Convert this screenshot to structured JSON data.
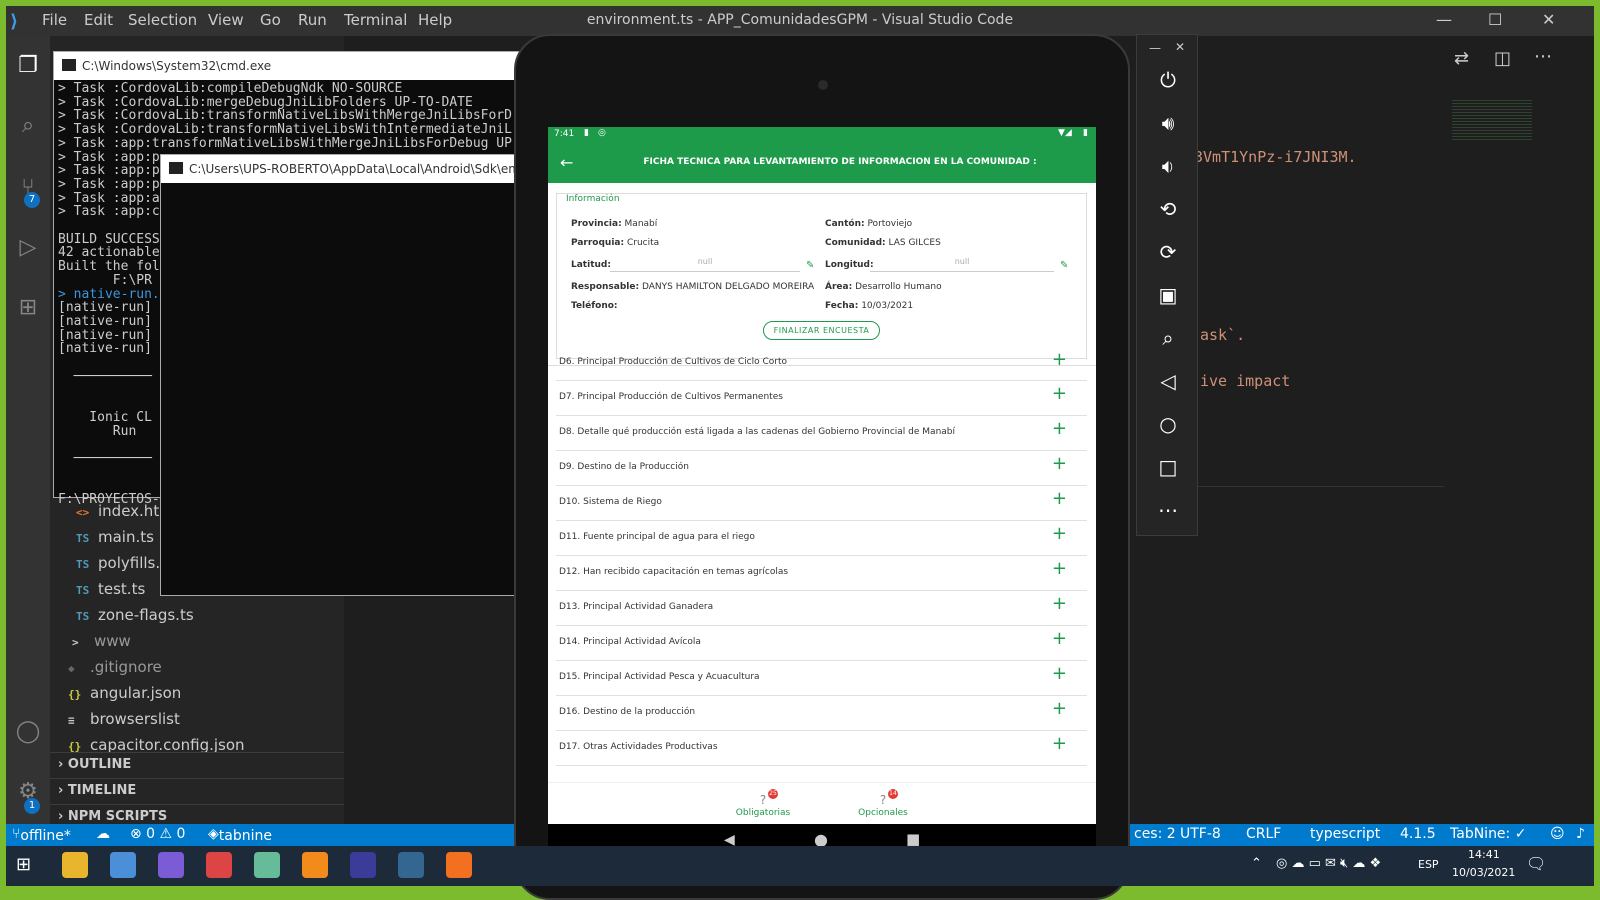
{
  "vscode": {
    "title": "environment.ts - APP_ComunidadesGPM - Visual Studio Code",
    "menu": [
      "File",
      "Edit",
      "Selection",
      "View",
      "Go",
      "Run",
      "Terminal",
      "Help"
    ],
    "badges": {
      "scm": "7",
      "settings": "1"
    },
    "tree": [
      {
        "icon": "<>",
        "name": "index.html",
        "label": "index.htm"
      },
      {
        "icon": "TS",
        "name": "main",
        "label": "main.ts"
      },
      {
        "icon": "TS",
        "name": "polyfills",
        "label": "polyfills.ts"
      },
      {
        "icon": "TS",
        "name": "test",
        "label": "test.ts"
      },
      {
        "icon": "TS",
        "name": "zone-flags",
        "label": "zone-flags.ts"
      },
      {
        "icon": ">",
        "name": "www",
        "label": "www"
      },
      {
        "icon": "◆",
        "name": "gitignore",
        "label": ".gitignore"
      },
      {
        "icon": "{}",
        "name": "angular-json",
        "label": "angular.json"
      },
      {
        "icon": "≡",
        "name": "browserslist",
        "label": "browserslist"
      },
      {
        "icon": "{}",
        "name": "capacitor-config",
        "label": "capacitor.config.json"
      }
    ],
    "panels": [
      "OUTLINE",
      "TIMELINE",
      "NPM SCRIPTS"
    ],
    "code": {
      "line1": "3VmT1YnPz-i7JNI3M.",
      "line2": "ask`.",
      "line3": "ive impact"
    },
    "status": {
      "branch": "offline*",
      "errors": "⊗ 0 ⚠ 0",
      "tabnine": "tabnine",
      "spaces": "ces: 2",
      "encoding": "UTF-8",
      "eol": "CRLF",
      "language": "typescript",
      "version": "4.1.5",
      "tabnine_status": "TabNine: ✓"
    }
  },
  "cmd1": {
    "title": "C:\\Windows\\System32\\cmd.exe",
    "lines": [
      "> Task :CordovaLib:compileDebugNdk NO-SOURCE",
      "> Task :CordovaLib:mergeDebugJniLibFolders UP-TO-DATE",
      "> Task :CordovaLib:transformNativeLibsWithMergeJniLibsForD",
      "> Task :CordovaLib:transformNativeLibsWithIntermediateJniL",
      "> Task :app:transformNativeLibsWithMergeJniLibsForDebug UP",
      "> Task :app:p",
      "> Task :app:p",
      "> Task :app:p",
      "> Task :app:a",
      "> Task :app:c",
      "",
      "BUILD SUCCESS",
      "42 actionable",
      "Built the fol",
      "       F:\\PR",
      "> native-run.",
      "[native-run]",
      "[native-run]",
      "[native-run]",
      "[native-run]",
      "",
      "  ──────────",
      "",
      "",
      "    Ionic CL",
      "       Run",
      "",
      "  ──────────",
      "",
      "",
      "F:\\PROYECTOS-"
    ]
  },
  "cmd2": {
    "title": "C:\\Users\\UPS-ROBERTO\\AppData\\Local\\Android\\Sdk\\emulator"
  },
  "phone": {
    "time": "7:41",
    "header_title": "FICHA TECNICA PARA LEVANTAMIENTO DE INFORMACION EN LA COMUNIDAD :",
    "info_legend": "Información",
    "labels": {
      "provincia": "Provincia:",
      "canton": "Cantón:",
      "parroquia": "Parroquia:",
      "comunidad": "Comunidad:",
      "latitud": "Latitud:",
      "longitud": "Longitud:",
      "responsable": "Responsable:",
      "area": "Área:",
      "telefono": "Teléfono:",
      "fecha": "Fecha:"
    },
    "values": {
      "provincia": "Manabí",
      "canton": "Portoviejo",
      "parroquia": "Crucita",
      "comunidad": "LAS GILCES",
      "latitud_placeholder": "null",
      "longitud_placeholder": "null",
      "responsable": "DANYS HAMILTON DELGADO MOREIRA",
      "area": "Desarrollo Humano",
      "fecha": "10/03/2021"
    },
    "finish_button": "FINALIZAR ENCUESTA",
    "items": [
      "D6. Principal Producción de Cultivos de Ciclo Corto",
      "D7. Principal Producción de Cultivos Permanentes",
      "D8. Detalle qué producción está ligada a las cadenas del Gobierno Provincial de Manabí",
      "D9. Destino de la Producción",
      "D10. Sistema de Riego",
      "D11. Fuente principal de agua para el riego",
      "D12. Han recibido capacitación en temas agrícolas",
      "D13. Principal Actividad Ganadera",
      "D14. Principal Actividad Avícola",
      "D15. Principal Actividad Pesca y Acuacultura",
      "D16. Destino de la producción",
      "D17. Otras Actividades Productivas"
    ],
    "tabs": [
      {
        "label": "Obligatorias",
        "badge": "25"
      },
      {
        "label": "Opcionales",
        "badge": "14"
      }
    ]
  },
  "taskbar": {
    "lang": "ESP",
    "time": "14:41",
    "date": "10/03/2021"
  },
  "colors": {
    "accent_green": "#1e9a4b",
    "vscode_blue": "#007acc",
    "desktop_green": "#7dbb2e"
  }
}
